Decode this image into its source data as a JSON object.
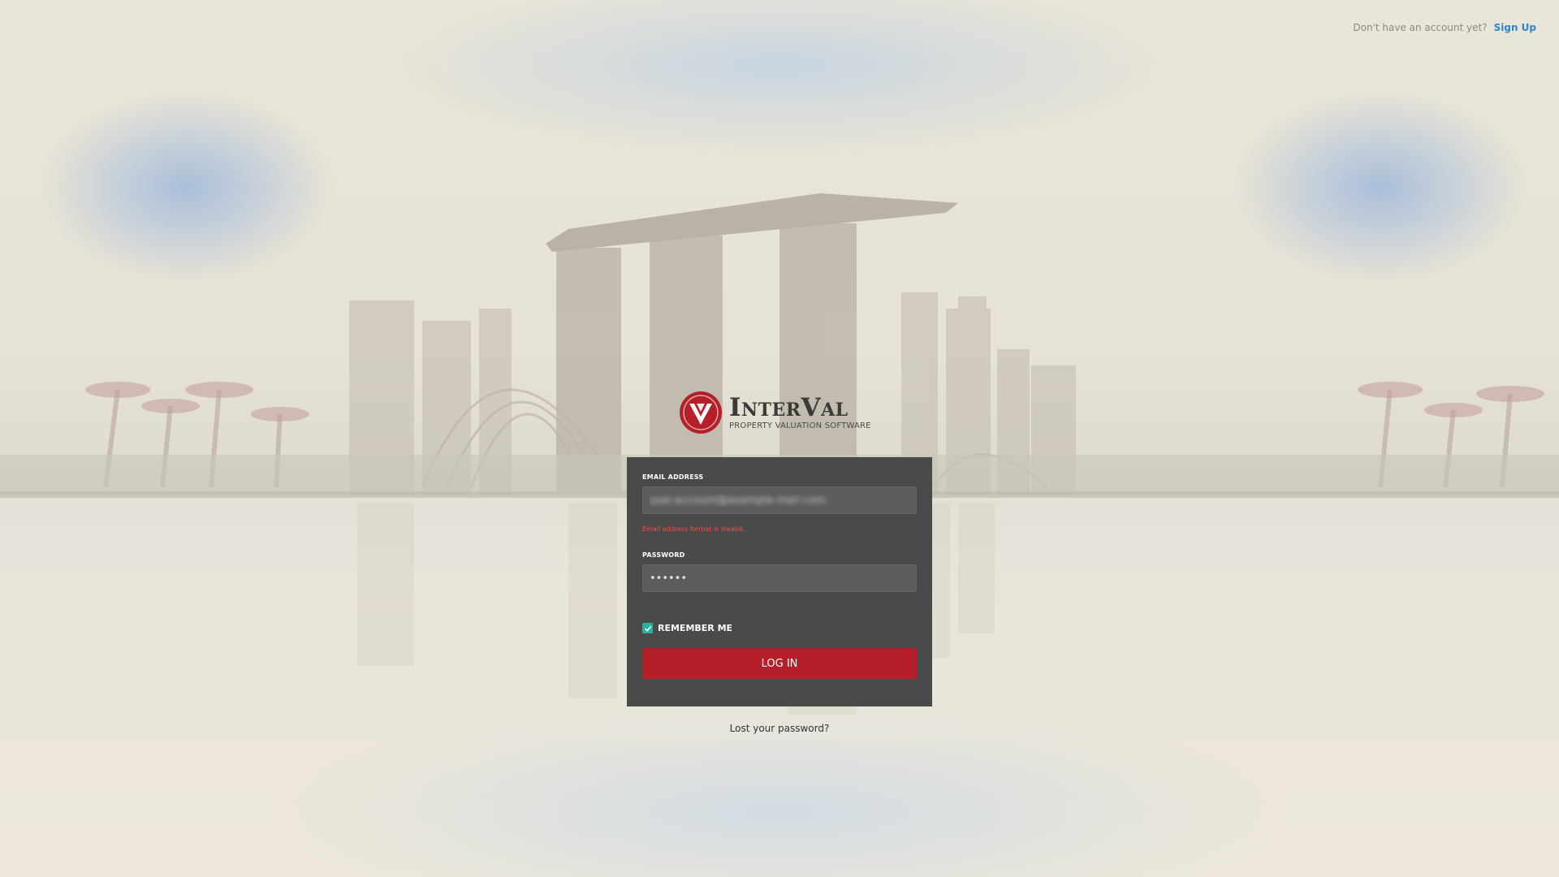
{
  "header": {
    "prompt": "Don't have an account yet?",
    "signup_label": "Sign Up"
  },
  "logo": {
    "name": "InterVal",
    "tagline": "PROPERTY VALUATION SOFTWARE",
    "accent_color": "#b51f2a"
  },
  "form": {
    "email_label": "EMAIL ADDRESS",
    "email_value": "user.account@example-mail.com",
    "email_error": "Email address format is invalid.",
    "password_label": "PASSWORD",
    "password_value": "••••••",
    "remember_label": "REMEMBER ME",
    "remember_checked": true,
    "login_label": "LOG IN"
  },
  "footer": {
    "lost_password": "Lost your password?"
  },
  "colors": {
    "card_bg": "#4a4a4a",
    "button_bg": "#b51f2a",
    "link": "#2b87d3",
    "error": "#ff4a4a",
    "checkbox": "#2bb3a1"
  }
}
